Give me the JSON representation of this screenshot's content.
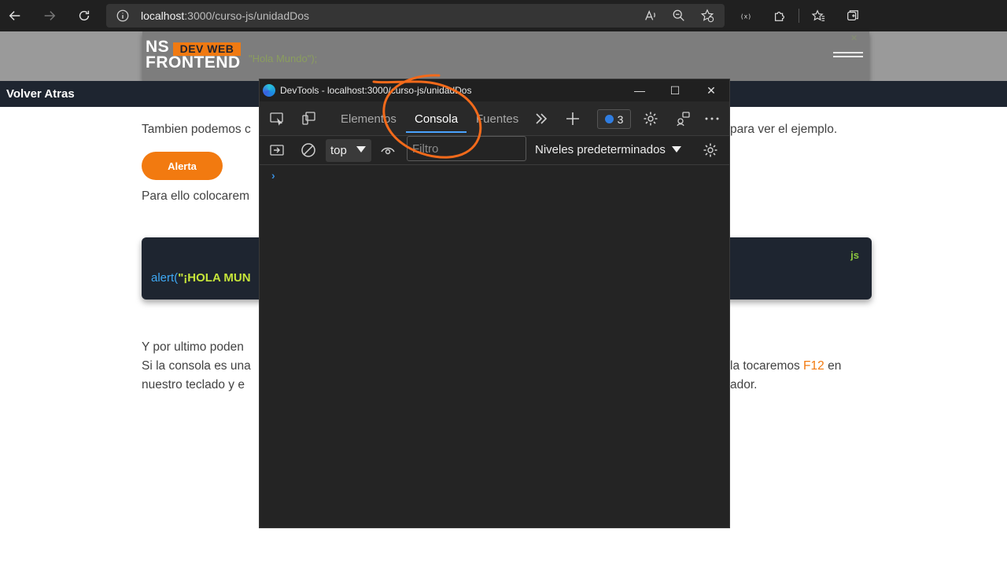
{
  "browser": {
    "url_host": "localhost",
    "url_rest": ":3000/curso-js/unidadDos",
    "icons": [
      "back-arrow-icon",
      "forward-arrow-icon",
      "refresh-icon",
      "info-icon",
      "read-aloud-icon",
      "zoom-out-icon",
      "favorites-add-icon",
      "extension-icon",
      "puzzle-icon",
      "favorites-icon",
      "collections-icon"
    ]
  },
  "site": {
    "logo_ns": "NS",
    "logo_devweb": "DEV WEB",
    "logo_frontend": "FRONTEND",
    "header_ghost": "\"Hola Mundo\");",
    "back_label": "Volver Atras"
  },
  "content": {
    "line1_left": "Tambien podemos c",
    "line1_right": "para ver el ejemplo.",
    "alert_button": "Alerta",
    "line2_left": "Para ello colocarem",
    "code_lang": "js",
    "code_fn": "alert(",
    "code_str": "\"¡HOLA MUN",
    "line3_left": "Y por ultimo poden",
    "line4_left": "Si la consola es una",
    "line4_right_a": "la tocaremos ",
    "line4_key": "F12",
    "line4_right_b": " en",
    "line5_left": "nuestro teclado y e",
    "line5_right": "ador."
  },
  "devtools": {
    "title": "DevTools - localhost:3000/curso-js/unidadDos",
    "tabs": [
      {
        "label": "Elementos"
      },
      {
        "label": "Consola"
      },
      {
        "label": "Fuentes"
      }
    ],
    "issues_count": "3",
    "context": "top",
    "filter_placeholder": "Filtro",
    "levels": "Niveles predeterminados",
    "prompt": "›"
  },
  "colors": {
    "accent_orange": "#f27a10",
    "devtools_tab_active": "#4aa3ff",
    "annotation": "#f26a1b"
  }
}
